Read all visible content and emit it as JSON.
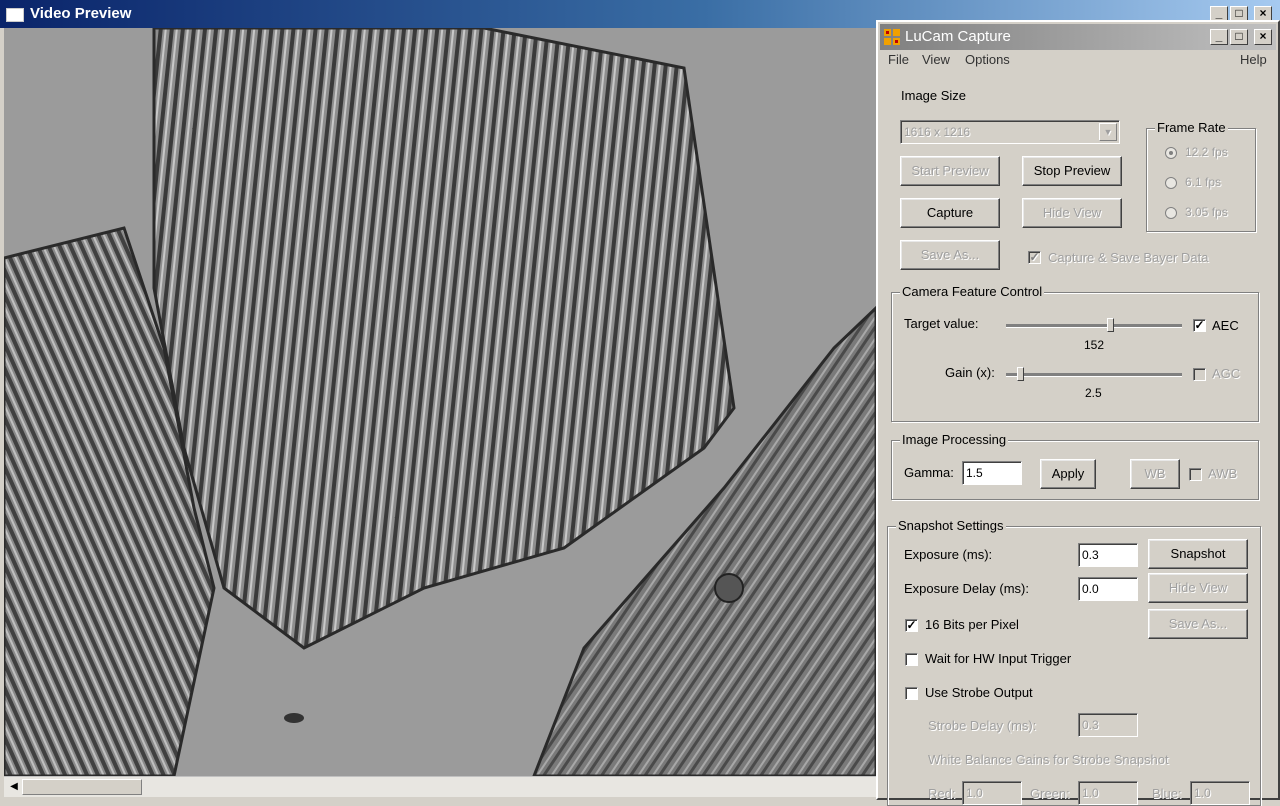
{
  "video_preview": {
    "title": "Video Preview",
    "title_buttons": [
      "_",
      "□",
      "×"
    ]
  },
  "lucam": {
    "title": "LuCam Capture",
    "title_buttons": [
      "_",
      "□",
      "×"
    ],
    "menu": {
      "file": "File",
      "view": "View",
      "options": "Options",
      "help": "Help"
    },
    "image_size": {
      "label": "Image Size",
      "selected": "1616 x 1216"
    },
    "frame_rate": {
      "label": "Frame Rate",
      "options": [
        "12.2 fps",
        "6.1 fps",
        "3.05 fps"
      ],
      "selected_index": 0
    },
    "buttons": {
      "start_preview": "Start Preview",
      "stop_preview": "Stop Preview",
      "capture": "Capture",
      "hide_view": "Hide View",
      "save_as": "Save As..."
    },
    "capture_bayer": {
      "label": "Capture & Save Bayer Data",
      "checked": true
    },
    "camera_feature": {
      "label": "Camera Feature Control",
      "target_label": "Target value:",
      "target_value": "152",
      "target_level": 0.59,
      "aec_label": "AEC",
      "aec_checked": true,
      "gain_label": "Gain (x):",
      "gain_value": "2.5",
      "gain_level": 0.08,
      "agc_label": "AGC",
      "agc_checked": false
    },
    "image_processing": {
      "label": "Image Processing",
      "gamma_label": "Gamma:",
      "gamma_value": "1.5",
      "apply": "Apply",
      "wb": "WB",
      "awb_label": "AWB"
    },
    "snapshot": {
      "label": "Snapshot Settings",
      "exposure_label": "Exposure (ms):",
      "exposure_value": "0.3",
      "snapshot_button": "Snapshot",
      "delay_label": "Exposure Delay (ms):",
      "delay_value": "0.0",
      "hide_view": "Hide View",
      "bits_label": "16 Bits per Pixel",
      "bits_checked": true,
      "save_as": "Save As...",
      "hw_trigger_label": "Wait for HW Input Trigger",
      "strobe_label": "Use Strobe Output",
      "strobe_delay_label": "Strobe Delay (ms):",
      "strobe_delay_value": "0.3",
      "wb_gains_label": "White Balance Gains for Strobe Snapshot",
      "red_label": "Red:",
      "red_value": "1.0",
      "green_label": "Green:",
      "green_value": "1.0",
      "blue_label": "Blue:",
      "blue_value": "1.0"
    }
  }
}
